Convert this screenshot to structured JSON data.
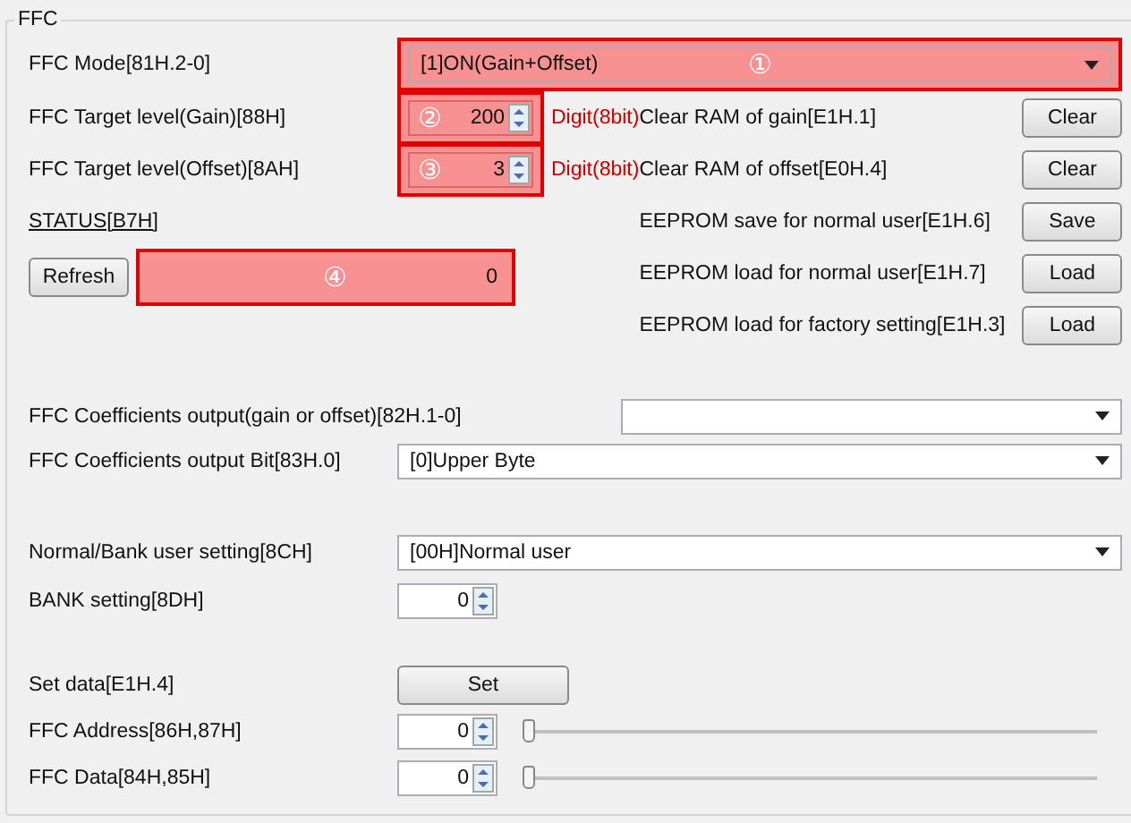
{
  "group": {
    "title": "FFC"
  },
  "mode": {
    "label": "FFC Mode[81H.2-0]",
    "value": "[1]ON(Gain+Offset)",
    "callout": "①"
  },
  "target_levels": [
    {
      "label": "FFC Target level(Gain)[88H]",
      "value": "200",
      "unit": "Digit(8bit)",
      "callout": "②"
    },
    {
      "label": "FFC Target level(Offset)[8AH]",
      "value": "3",
      "unit": "Digit(8bit)",
      "callout": "③"
    }
  ],
  "status": {
    "label": "STATUS[B7H]",
    "button": "Refresh",
    "value": "0",
    "callout": "④"
  },
  "commands": [
    {
      "label": "Clear RAM of gain[E1H.1]",
      "button": "Clear"
    },
    {
      "label": "Clear RAM of offset[E0H.4]",
      "button": "Clear"
    },
    {
      "label": "EEPROM save for normal user[E1H.6]",
      "button": "Save"
    },
    {
      "label": "EEPROM load for normal user[E1H.7]",
      "button": "Load"
    },
    {
      "label": "EEPROM load for factory setting[E1H.3]",
      "button": "Load"
    }
  ],
  "coefficients_output": {
    "label": "FFC Coefficients output(gain or offset)[82H.1-0]"
  },
  "coefficients_bit": {
    "label": "FFC Coefficients output Bit[83H.0]",
    "value": "[0]Upper Byte"
  },
  "user_setting": {
    "label": "Normal/Bank user setting[8CH]",
    "value": "[00H]Normal user"
  },
  "bank": {
    "label": "BANK setting[8DH]",
    "value": "0"
  },
  "set_data": {
    "label": "Set data[E1H.4]",
    "button": "Set"
  },
  "sliders": [
    {
      "label": "FFC Address[86H,87H]",
      "value": "0",
      "level": 0
    },
    {
      "label": "FFC Data[84H,85H]",
      "value": "0",
      "level": 0
    }
  ]
}
